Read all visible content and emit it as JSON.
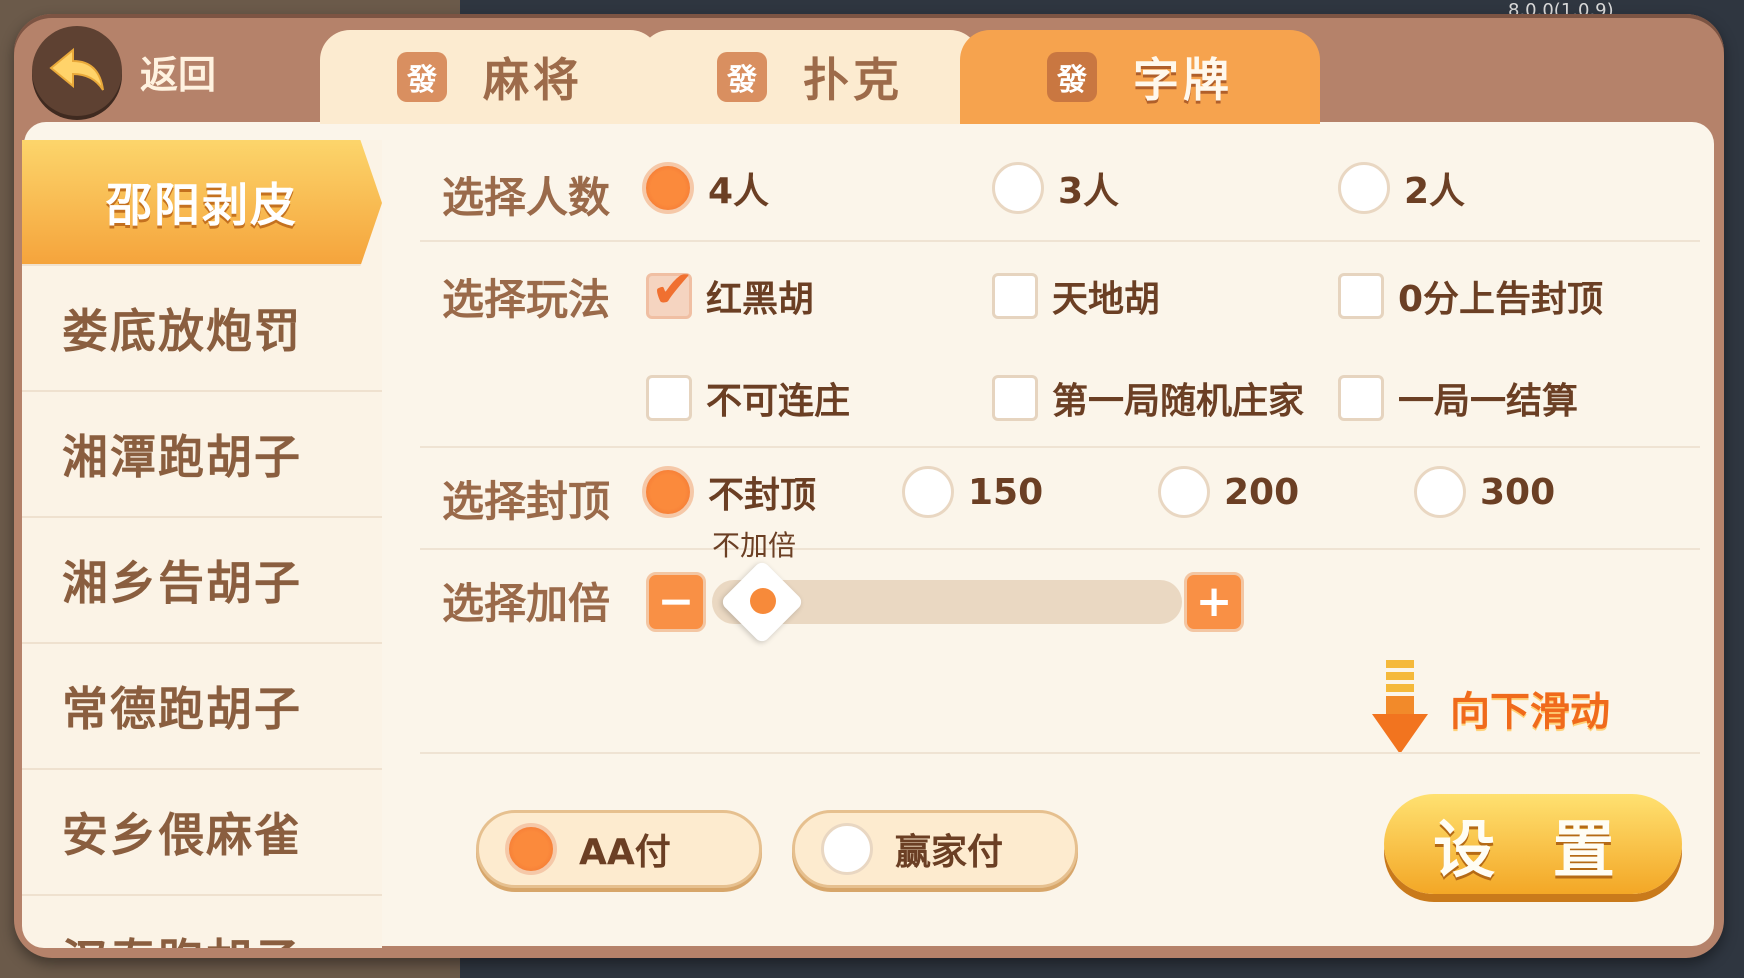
{
  "version": "8.0.0(1.0.9)",
  "header": {
    "back_label": "返回"
  },
  "tabs": [
    {
      "icon": "發",
      "label": "麻将"
    },
    {
      "icon": "發",
      "label": "扑克"
    },
    {
      "icon": "發",
      "label": "字牌",
      "active": true
    }
  ],
  "sidebar": {
    "items": [
      {
        "label": "邵阳剥皮",
        "active": true
      },
      {
        "label": "娄底放炮罚"
      },
      {
        "label": "湘潭跑胡子"
      },
      {
        "label": "湘乡告胡子"
      },
      {
        "label": "常德跑胡子"
      },
      {
        "label": "安乡偎麻雀"
      },
      {
        "label": "汉寿跑胡子"
      }
    ]
  },
  "players": {
    "title": "选择人数",
    "options": [
      {
        "label": "4人",
        "selected": true
      },
      {
        "label": "3人",
        "selected": false
      },
      {
        "label": "2人",
        "selected": false
      }
    ]
  },
  "play": {
    "title": "选择玩法",
    "options": [
      {
        "label": "红黑胡",
        "checked": true
      },
      {
        "label": "天地胡",
        "checked": false
      },
      {
        "label": "0分上告封顶",
        "checked": false
      },
      {
        "label": "不可连庄",
        "checked": false
      },
      {
        "label": "第一局随机庄家",
        "checked": false
      },
      {
        "label": "一局一结算",
        "checked": false
      }
    ]
  },
  "cap": {
    "title": "选择封顶",
    "options": [
      {
        "label": "不封顶",
        "selected": true
      },
      {
        "label": "150",
        "selected": false
      },
      {
        "label": "200",
        "selected": false
      },
      {
        "label": "300",
        "selected": false
      }
    ]
  },
  "double": {
    "title": "选择加倍",
    "value_label": "不加倍",
    "minus": "−",
    "plus": "+",
    "level": 0
  },
  "scroll_hint": "向下滑动",
  "payment": [
    {
      "label": "AA付",
      "selected": true
    },
    {
      "label": "赢家付",
      "selected": false
    }
  ],
  "confirm_label": "设 置",
  "colors": {
    "accent": "#f6a34e",
    "selected": "#f07030",
    "brown": "#9a6a4a"
  }
}
